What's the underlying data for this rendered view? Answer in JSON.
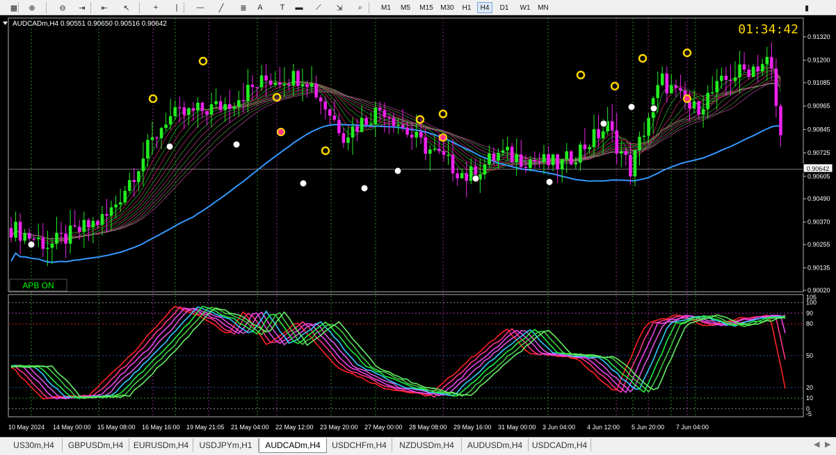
{
  "toolbar": {
    "timeframes": [
      "M1",
      "M5",
      "M15",
      "M30",
      "H1",
      "H4",
      "D1",
      "W1",
      "MN"
    ],
    "active_timeframe": "H4",
    "tools": [
      "chart-grid-icon",
      "zoom-in-icon",
      "zoom-out-icon",
      "chart-scroll-icon",
      "chart-shift-icon",
      "cursor-icon",
      "crosshair-icon",
      "vertical-line-icon",
      "horizontal-line-icon",
      "trendline-icon",
      "fibonacci-icon",
      "text-icon",
      "text-label-icon",
      "rectangle-icon",
      "fib-fan-icon",
      "arrows-menu-icon",
      "search-icon",
      "signal-icon"
    ]
  },
  "chart": {
    "header": "AUDCADm,H4  0.90551 0.90650 0.90516 0.90642",
    "clock": "01:34:42",
    "current_price": "0.90642",
    "apb_label": "APB ON",
    "price_labels": [
      "0.91320",
      "0.91200",
      "0.91085",
      "0.90965",
      "0.90845",
      "0.90725",
      "0.90605",
      "0.90490",
      "0.90370",
      "0.90255",
      "0.90135",
      "0.90020"
    ],
    "osc_labels": [
      "105",
      "100",
      "90",
      "80",
      "50",
      "20",
      "10",
      "0",
      "-5"
    ],
    "time_labels": [
      "10 May 2024",
      "14 May 00:00",
      "15 May 08:00",
      "16 May 16:00",
      "19 May 21:05",
      "21 May 04:00",
      "22 May 12:00",
      "23 May 20:00",
      "27 May 00:00",
      "28 May 08:00",
      "29 May 16:00",
      "31 May 00:00",
      "3 Jun 04:00",
      "4 Jun 12:00",
      "5 Jun 20:00",
      "7 Jun 04:00"
    ],
    "colors": {
      "background": "#000000",
      "bull": "#22ee22",
      "bear": "#ee22ee",
      "ribbon_up": "#33cc33",
      "ribbon_down": "#ff3366",
      "baseline": "#3399ff",
      "clock": "#ffd700",
      "apb_text": "#00ff00"
    }
  },
  "tabs": {
    "items": [
      "US30m,H4",
      "GBPUSDm,H4",
      "EURUSDm,H4",
      "USDJPYm,H1",
      "AUDCADm,H4",
      "USDCHFm,H4",
      "NZDUSDm,H4",
      "AUDUSDm,H4",
      "USDCADm,H4"
    ],
    "active_index": 4
  }
}
